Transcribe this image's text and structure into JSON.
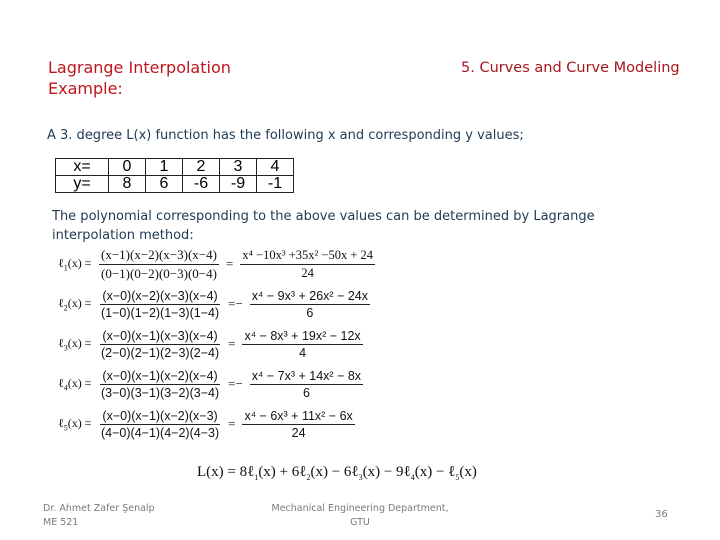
{
  "header": {
    "title_line1": "Lagrange Interpolation",
    "title_line2": "Example:",
    "section": "5. Curves and Curve Modeling"
  },
  "intro": "A 3. degree L(x) function has the following x and corresponding y values;",
  "table": {
    "x_label": "x=",
    "y_label": "y=",
    "x": [
      "0",
      "1",
      "2",
      "3",
      "4"
    ],
    "y": [
      "8",
      "6",
      "-6",
      "-9",
      "-1"
    ]
  },
  "method_text": "The polynomial corresponding to the above values can be determined by Lagrange interpolation method:",
  "equations": [
    {
      "name": "ℓ",
      "index": "1",
      "arg": "(x) =",
      "num": "(x−1)(x−2)(x−3)(x−4)",
      "den": "(0−1)(0−2)(0−3)(0−4)",
      "sign": "=",
      "res_num": "x⁴ −10x³ +35x² −50x + 24",
      "res_den": "24"
    },
    {
      "name": "ℓ",
      "index": "2",
      "arg": "(x) =",
      "num": "(x−0)(x−2)(x−3)(x−4)",
      "den": "(1−0)(1−2)(1−3)(1−4)",
      "sign": "=−",
      "res_num": "x⁴ − 9x³ + 26x² − 24x",
      "res_den": "6"
    },
    {
      "name": "ℓ",
      "index": "3",
      "arg": "(x) =",
      "num": "(x−0)(x−1)(x−3)(x−4)",
      "den": "(2−0)(2−1)(2−3)(2−4)",
      "sign": "=",
      "res_num": "x⁴ − 8x³ + 19x² − 12x",
      "res_den": "4"
    },
    {
      "name": "ℓ",
      "index": "4",
      "arg": "(x) =",
      "num": "(x−0)(x−1)(x−2)(x−4)",
      "den": "(3−0)(3−1)(3−2)(3−4)",
      "sign": "=−",
      "res_num": "x⁴ − 7x³ + 14x² − 8x",
      "res_den": "6"
    },
    {
      "name": "ℓ",
      "index": "5",
      "arg": "(x) =",
      "num": "(x−0)(x−1)(x−2)(x−3)",
      "den": "(4−0)(4−1)(4−2)(4−3)",
      "sign": "=",
      "res_num": "x⁴ − 6x³ + 11x² − 6x",
      "res_den": "24"
    }
  ],
  "final": {
    "lhs": "L(x) = 8ℓ",
    "t1_sub": "1",
    "t1_rest": "(x) + 6ℓ",
    "t2_sub": "2",
    "t2_rest": "(x) − 6ℓ",
    "t3_sub": "3",
    "t3_rest": "(x) − 9ℓ",
    "t4_sub": "4",
    "t4_rest": "(x) − ℓ",
    "t5_sub": "5",
    "t5_rest": "(x)"
  },
  "footer": {
    "author": "Dr. Ahmet Zafer Şenalp",
    "course": "ME 521",
    "dept_line1": "Mechanical Engineering Department,",
    "dept_line2": "GTU",
    "page": "36"
  }
}
